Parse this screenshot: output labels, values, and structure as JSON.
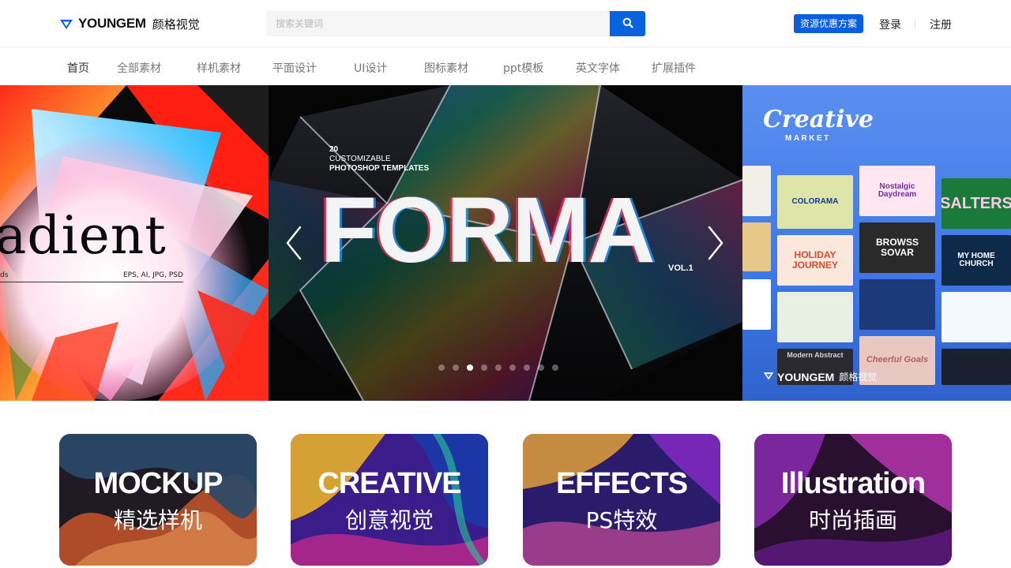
{
  "header": {
    "logo_en": "YOUNGEM",
    "logo_cn": "颜格视觉",
    "search_placeholder": "搜索关键词",
    "search_value": "",
    "promo_label": "资源优惠方案",
    "login_label": "登录",
    "register_label": "注册"
  },
  "nav": {
    "items": [
      "首页",
      "全部素材",
      "样机素材",
      "平面设计",
      "UI设计",
      "图标素材",
      "ppt模板",
      "英文字体",
      "扩展插件"
    ],
    "active_index": 0
  },
  "carousel": {
    "left": {
      "headline": "adient",
      "meta_left": "ds",
      "meta_right": "EPS, AI, JPG, PSD"
    },
    "main": {
      "line1": "20",
      "line2": "CUSTOMIZABLE",
      "line3": "PHOTOSHOP TEMPLATES",
      "headline": "FORMA",
      "volume": "VOL.1"
    },
    "right": {
      "brand": "Creative",
      "brand_sub": "MARKET",
      "thumbs": [
        "COLORAMA",
        "Nostalgic Daydream",
        "SALTERS",
        "HOLIDAY JOURNEY",
        "BROWSS SOVAR",
        "MY HOME CHURCH",
        "Modern Abstract",
        "Cheerful Goals"
      ],
      "watermark_en": "YOUNGEM",
      "watermark_cn": "颜格视觉"
    },
    "dot_count": 9,
    "active_dot": 2
  },
  "categories": [
    {
      "en": "MOCKUP",
      "cn": "精选样机"
    },
    {
      "en": "CREATIVE",
      "cn": "创意视觉"
    },
    {
      "en": "EFFECTS",
      "cn": "PS特效"
    },
    {
      "en": "Illustration",
      "cn": "时尚插画"
    }
  ],
  "colors": {
    "brand_blue": "#0a63de",
    "nav_text": "#777777",
    "nav_active": "#333333"
  },
  "icons": {
    "logo": "diamond-logo-icon",
    "search": "search-icon",
    "prev": "chevron-left-icon",
    "next": "chevron-right-icon"
  }
}
